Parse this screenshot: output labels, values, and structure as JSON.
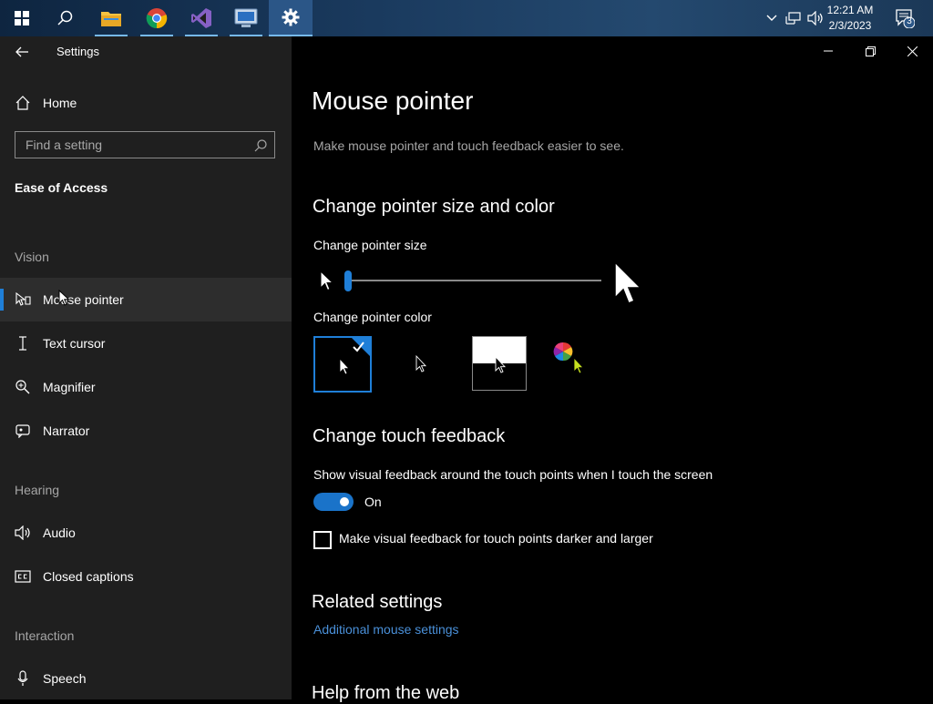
{
  "taskbar": {
    "apps": [
      {
        "name": "file-explorer"
      },
      {
        "name": "chrome"
      },
      {
        "name": "visual-studio"
      },
      {
        "name": "remote-desktop"
      },
      {
        "name": "settings"
      }
    ],
    "clock": {
      "time": "12:21 AM",
      "date": "2/3/2023"
    },
    "notifications_count": "3"
  },
  "window": {
    "title": "Settings"
  },
  "sidebar": {
    "home_label": "Home",
    "search_placeholder": "Find a setting",
    "category": "Ease of Access",
    "sections": {
      "vision": "Vision",
      "hearing": "Hearing",
      "interaction": "Interaction"
    },
    "items": [
      {
        "label": "Mouse pointer",
        "selected": true
      },
      {
        "label": "Text cursor"
      },
      {
        "label": "Magnifier"
      },
      {
        "label": "Narrator"
      },
      {
        "label": "Audio"
      },
      {
        "label": "Closed captions"
      },
      {
        "label": "Speech"
      }
    ]
  },
  "main": {
    "title": "Mouse pointer",
    "subtitle": "Make mouse pointer and touch feedback easier to see.",
    "size_color_heading": "Change pointer size and color",
    "size_label": "Change pointer size",
    "color_label": "Change pointer color",
    "pointer_size_value": 1,
    "touch_heading": "Change touch feedback",
    "touch_show_label": "Show visual feedback around the touch points when I touch the screen",
    "touch_toggle_state": "On",
    "touch_darker_label": "Make visual feedback for touch points darker and larger",
    "related_heading": "Related settings",
    "related_link": "Additional mouse settings",
    "help_heading": "Help from the web"
  },
  "colors": {
    "accent": "#1f7fd8",
    "link": "#4a90d9",
    "sidebar_bg": "#1f1f1f",
    "main_bg": "#000000"
  }
}
